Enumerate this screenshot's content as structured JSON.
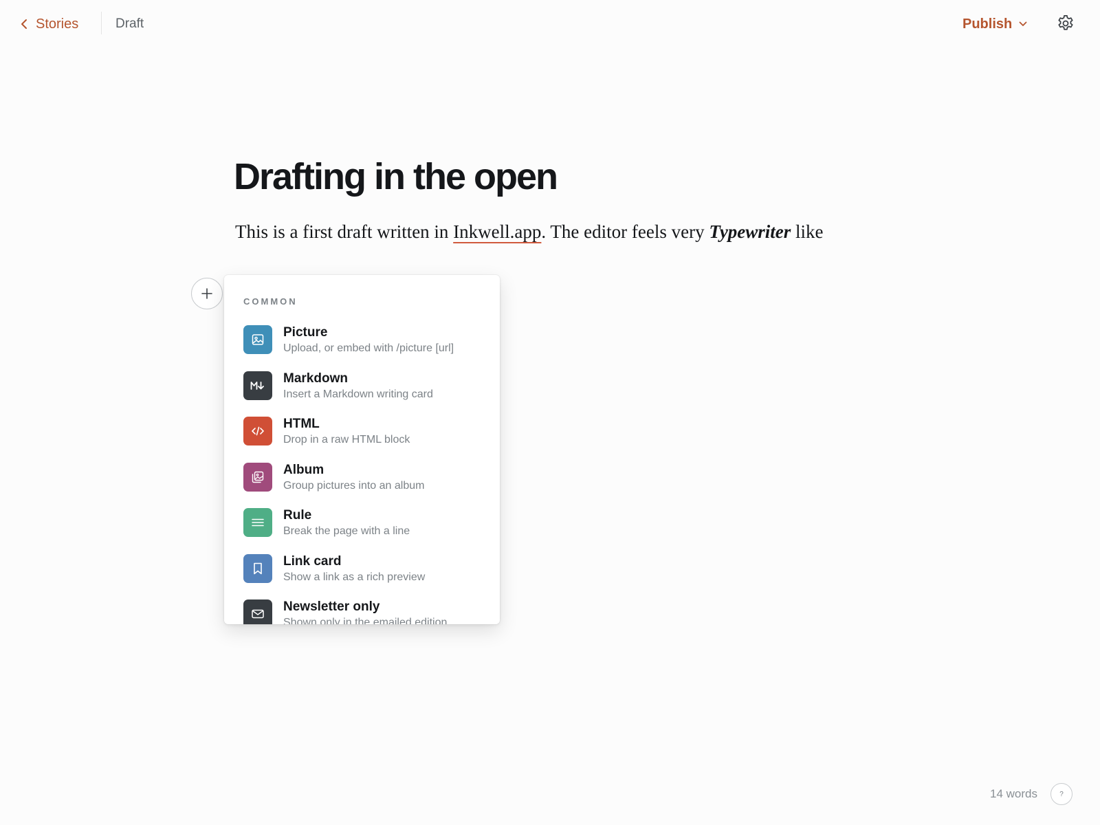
{
  "topbar": {
    "back_label": "Stories",
    "status": "Draft",
    "publish_label": "Publish"
  },
  "post": {
    "title": "Drafting in the open",
    "body": {
      "part1": "This is a first draft written in ",
      "link": "Inkwell.app",
      "part2": ". The editor feels very ",
      "emphasis": "Typewriter",
      "part3": " like"
    }
  },
  "card_menu": {
    "section_title": "COMMON",
    "items": [
      {
        "title": "Picture",
        "description": "Upload, or embed with /picture [url]",
        "icon": "picture-icon",
        "color": "#3f8fb8"
      },
      {
        "title": "Markdown",
        "description": "Insert a Markdown writing card",
        "icon": "markdown-icon",
        "color": "#383d42"
      },
      {
        "title": "HTML",
        "description": "Drop in a raw HTML block",
        "icon": "code-icon",
        "color": "#d04f36"
      },
      {
        "title": "Album",
        "description": "Group pictures into an album",
        "icon": "album-icon",
        "color": "#a04b7c"
      },
      {
        "title": "Rule",
        "description": "Break the page with a line",
        "icon": "divider-icon",
        "color": "#4fae86"
      },
      {
        "title": "Link card",
        "description": "Show a link as a rich preview",
        "icon": "bookmark-icon",
        "color": "#5482bb"
      },
      {
        "title": "Newsletter only",
        "description": "Shown only in the emailed edition",
        "icon": "email-icon",
        "color": "#383d42"
      }
    ]
  },
  "footer": {
    "word_count": "14 words",
    "help_label": "?"
  },
  "colors": {
    "accent": "#b5552e",
    "link_underline": "#d05a3d"
  }
}
